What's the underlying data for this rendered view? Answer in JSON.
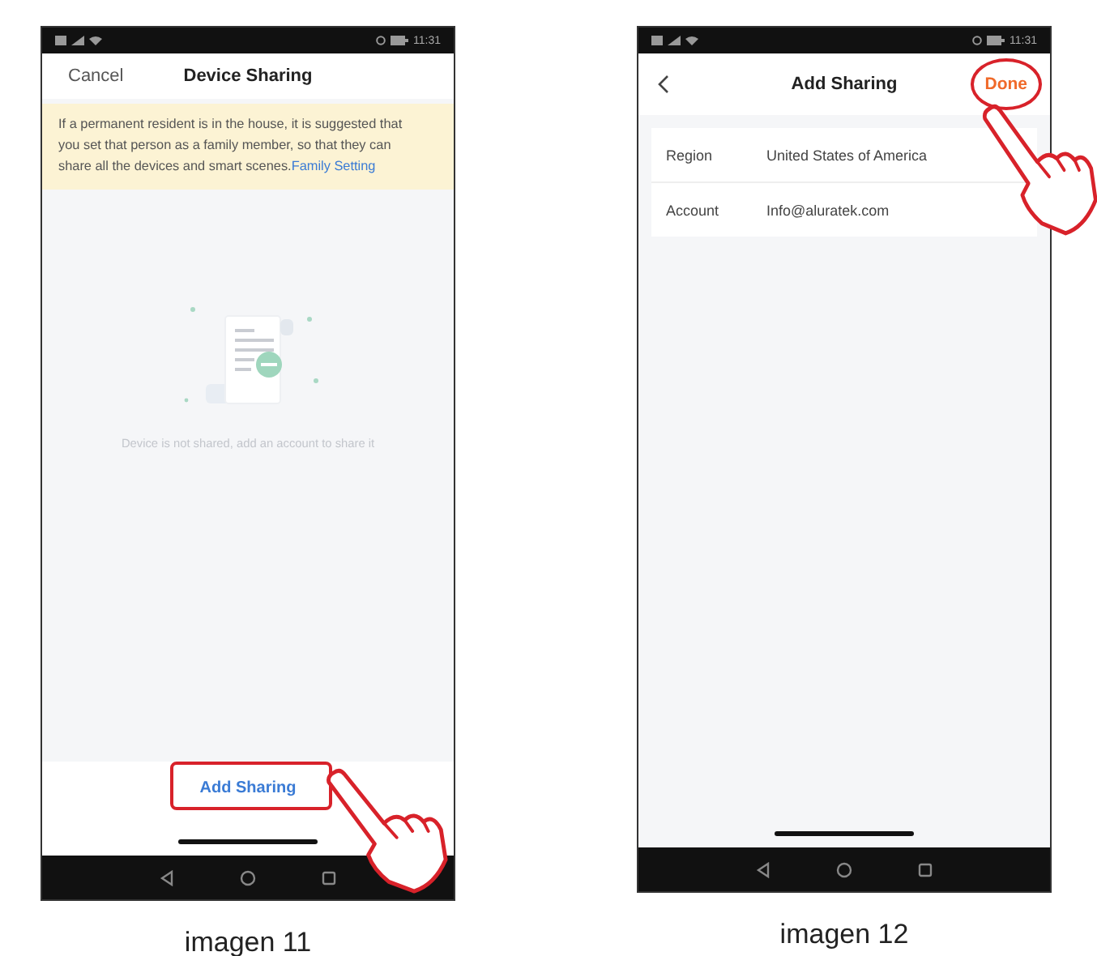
{
  "figures": [
    {
      "kind": "device_sharing",
      "status_time": "11:31",
      "cancel": "Cancel",
      "title": "Device Sharing",
      "notice": "If a permanent resident is in the house, it is suggested that you set that person as a family member, so that they can share all the devices and smart scenes.",
      "notice_link": "Family Setting",
      "empty_text": "Device is not shared, add an account to share it",
      "action": {
        "label": "Add Sharing",
        "highlighted": true
      },
      "caption": "imagen 11"
    },
    {
      "kind": "add_sharing",
      "status_time": "11:31",
      "title": "Add Sharing",
      "done": {
        "label": "Done",
        "highlighted": true
      },
      "fields": [
        {
          "label": "Region",
          "value": "United States of America"
        },
        {
          "label": "Account",
          "value": "Info@aluratek.com"
        }
      ],
      "caption": "imagen 12"
    }
  ]
}
